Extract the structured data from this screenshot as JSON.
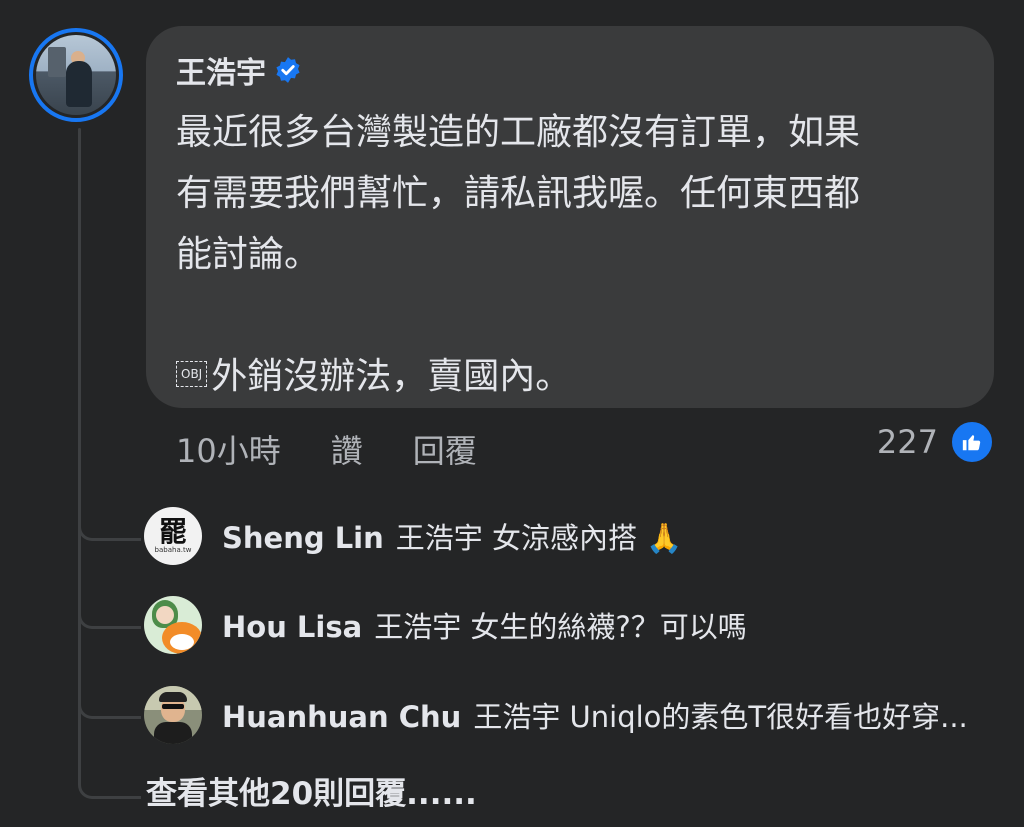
{
  "comment": {
    "author": "王浩宇",
    "verified": true,
    "text_lines": [
      "最近很多台灣製造的工廠都沒有訂單，如果",
      "有需要我們幫忙，請私訊我喔。任何東西都",
      "能討論。",
      ""
    ],
    "obj_label": "OBJ",
    "last_line": "外銷沒辦法，賣國內。",
    "time": "10小時",
    "like_action": "讚",
    "reply_action": "回覆",
    "reaction_count": "227",
    "reaction_icon": "thumbs-up-icon"
  },
  "replies": [
    {
      "author": "Sheng Lin",
      "text": "王浩宇 女涼感內搭 🙏",
      "avatar_label": "罷",
      "avatar_sub": "babaha.tw"
    },
    {
      "author": "Hou Lisa",
      "text": "王浩宇 女生的絲襪?？可以嗎"
    },
    {
      "author": "Huanhuan Chu",
      "text": "王浩宇 Uniqlo的素色T很好看也好穿..."
    }
  ],
  "more_replies_label": "查看其他20則回覆......",
  "colors": {
    "background": "#242526",
    "bubble": "#3a3b3c",
    "accent": "#1877f2",
    "text_primary": "#e4e6eb",
    "text_secondary": "#b0b3b8"
  }
}
